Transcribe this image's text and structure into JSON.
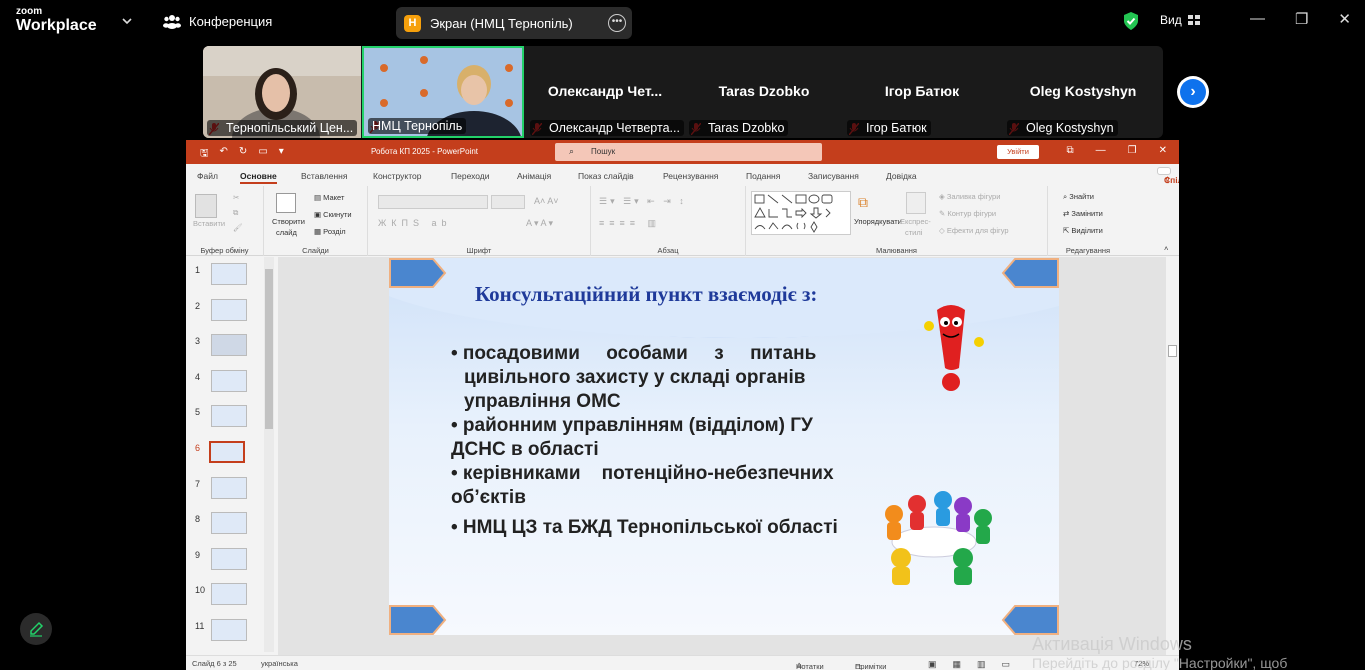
{
  "zoom": {
    "logo_top": "zoom",
    "logo_bottom": "Workplace",
    "conference_label": "Конференция",
    "share_badge": "Н",
    "share_label": "Экран (НМЦ Тернопіль)",
    "view_label": "Вид"
  },
  "participants": [
    {
      "name": "Тернопільський Цен...",
      "video": true
    },
    {
      "name": "НМЦ Тернопіль",
      "video": true,
      "active_speaker": true
    },
    {
      "name": "Олександр Четверта...",
      "display": "Олександр  Чет..."
    },
    {
      "name": "Taras Dzobko",
      "display": "Taras Dzobko"
    },
    {
      "name": "Ігор Батюк",
      "display": "Ігор Батюк"
    },
    {
      "name": "Oleg Kostyshyn",
      "display": "Oleg Kostyshyn"
    }
  ],
  "ppt": {
    "filename": "Робота КП 2025  -  PowerPoint",
    "search_placeholder": "Пошук",
    "signin": "Увійти",
    "tabs": [
      "Файл",
      "Основне",
      "Вставлення",
      "Конструктор",
      "Переходи",
      "Анімація",
      "Показ слайдів",
      "Рецензування",
      "Подання",
      "Записування",
      "Довідка"
    ],
    "share_button": "Спільний доступ",
    "ribbon": {
      "paste": "Вставити",
      "clipboard": "Буфер обміну",
      "new_slide_1": "Створити",
      "new_slide_2": "слайд",
      "layout": "Макет",
      "reset": "Скинути",
      "section": "Розділ",
      "slides": "Слайди",
      "font": "Шрифт",
      "paragraph": "Абзац",
      "arrange": "Упорядкувати",
      "quick_styles_1": "Експрес-",
      "quick_styles_2": "стилі",
      "fill": "Заливка фігури",
      "outline": "Контур фігури",
      "effects": "Ефекти для фігур",
      "drawing": "Малювання",
      "find": "Знайти",
      "replace": "Замінити",
      "select": "Виділити",
      "editing": "Редагування"
    },
    "slide_numbers": [
      "1",
      "2",
      "3",
      "4",
      "5",
      "6",
      "7",
      "8",
      "9",
      "10",
      "11"
    ],
    "selected_slide": 6,
    "status": {
      "slide_counter": "Слайд 6 з 25",
      "language": "українська",
      "notes": "Нотатки",
      "comments": "Примітки",
      "zoom": "72%"
    }
  },
  "slide": {
    "title": "Консультаційний пункт взаємодіє з:",
    "bullet1_line1": "• посадовими     особами     з     питань",
    "bullet1_line2": "цивільного захисту у складі органів",
    "bullet1_line3": "управління ОМС",
    "bullet2_line1": "• районним управлінням (відділом) ГУ",
    "bullet2_line2": "ДСНС в області",
    "bullet3_line1": "• керівниками    потенційно-небезпечних",
    "bullet3_line2": "об’єктів",
    "bullet4": "• НМЦ ЦЗ та БЖД Тернопільської області"
  },
  "watermark": {
    "line1": "Активація Windows",
    "line2": "Перейдіть до розділу \"Настройки\", щоб"
  }
}
